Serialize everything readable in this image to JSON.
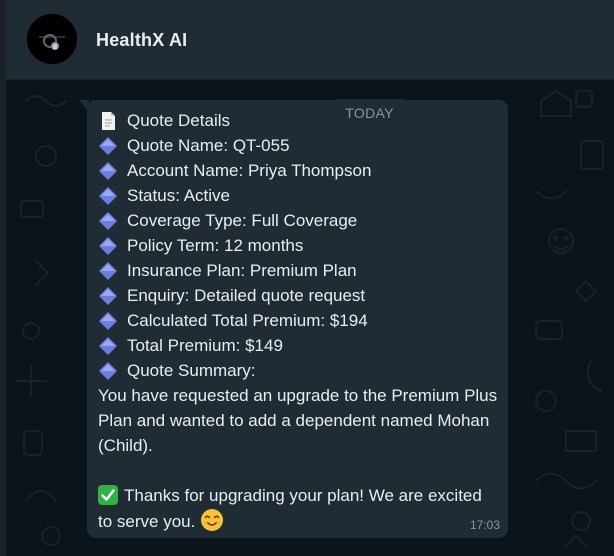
{
  "chat": {
    "title": "HealthX AI",
    "avatar_icon": "robot-avatar-icon",
    "date_separator": "TODAY"
  },
  "message": {
    "heading": "Quote Details",
    "heading_icon": "page-icon",
    "bullet_icon": "blue-diamond-icon",
    "fields": [
      "Quote Name: QT-055",
      "Account Name: Priya Thompson",
      "Status: Active",
      "Coverage Type: Full Coverage",
      "Policy Term: 12 months",
      "Insurance Plan: Premium Plan",
      "Enquiry: Detailed quote request",
      "Calculated Total Premium: $194",
      "Total Premium: $149",
      "Quote Summary:"
    ],
    "summary": "You have requested an upgrade to the Premium Plus Plan and wanted to add a dependent named Mohan (Child).",
    "closing_icon": "check-mark-icon",
    "closing": "Thanks for upgrading your plan! We are excited to serve you.",
    "closing_emoji": "😊",
    "timestamp": "17:03"
  },
  "colors": {
    "header_bg": "#202c33",
    "chat_bg": "#0b141a",
    "bubble_bg": "#202c33",
    "text": "#e9edef",
    "muted": "#8696a0",
    "diamond": "#6b7fe0",
    "check": "#2fb344"
  }
}
